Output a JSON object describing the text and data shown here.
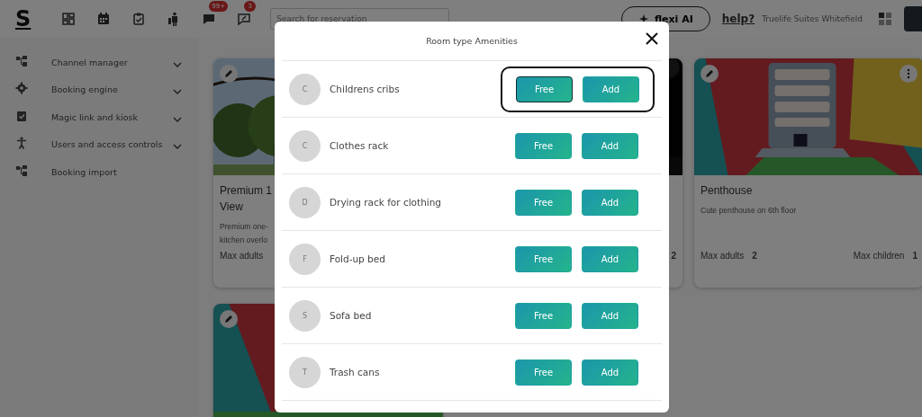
{
  "topbar": {
    "logo": "S",
    "notifications": [
      {
        "badge": "99+"
      },
      {
        "badge": "3"
      }
    ],
    "search": {
      "placeholder": "Search for reservation"
    },
    "ai_button": "flexi AI",
    "help_link": "help?",
    "property_name": "Truelife Suites Whitefield"
  },
  "sidebar": {
    "items": [
      {
        "label": "Channel manager",
        "has_submenu": true
      },
      {
        "label": "Booking engine",
        "has_submenu": true
      },
      {
        "label": "Magic link and kiosk",
        "has_submenu": true
      },
      {
        "label": "Users and access controls",
        "has_submenu": true
      },
      {
        "label": "Booking import",
        "has_submenu": false
      }
    ]
  },
  "room_cards": [
    {
      "kind": "picture",
      "title_lines": [
        "Premium 1",
        "View"
      ],
      "description_lines": [
        "Premium one-",
        "kitchen overlo"
      ],
      "stats": [
        {
          "label": "Max adults"
        }
      ]
    },
    {
      "kind": "picture",
      "stats": [
        {
          "value": "2"
        }
      ]
    },
    {
      "kind": "picture",
      "title_lines": [
        "Penthouse"
      ],
      "description_lines": [
        "Cute penthouse on 6th floor"
      ],
      "stats": [
        {
          "label": "Max adults",
          "value": "2"
        },
        {
          "label": "Max children",
          "value": "1"
        }
      ],
      "menu": true
    },
    {
      "kind": "picture"
    }
  ],
  "modal": {
    "title": "Room type Amenities",
    "amenities": [
      {
        "initial": "C",
        "name": "Childrens cribs",
        "outlined": true,
        "buttons": [
          {
            "label": "Free",
            "selected": true
          },
          {
            "label": "Add",
            "selected": false
          }
        ]
      },
      {
        "initial": "C",
        "name": "Clothes rack",
        "outlined": false,
        "buttons": [
          {
            "label": "Free",
            "selected": false
          },
          {
            "label": "Add",
            "selected": false
          }
        ]
      },
      {
        "initial": "D",
        "name": "Drying rack for clothing",
        "outlined": false,
        "buttons": [
          {
            "label": "Free",
            "selected": false
          },
          {
            "label": "Add",
            "selected": false
          }
        ]
      },
      {
        "initial": "F",
        "name": "Fold-up bed",
        "outlined": false,
        "buttons": [
          {
            "label": "Free",
            "selected": false
          },
          {
            "label": "Add",
            "selected": false
          }
        ]
      },
      {
        "initial": "S",
        "name": "Sofa bed",
        "outlined": false,
        "buttons": [
          {
            "label": "Free",
            "selected": false
          },
          {
            "label": "Add",
            "selected": false
          }
        ]
      },
      {
        "initial": "T",
        "name": "Trash cans",
        "outlined": false,
        "buttons": [
          {
            "label": "Free",
            "selected": false
          },
          {
            "label": "Add",
            "selected": false
          }
        ]
      }
    ]
  }
}
